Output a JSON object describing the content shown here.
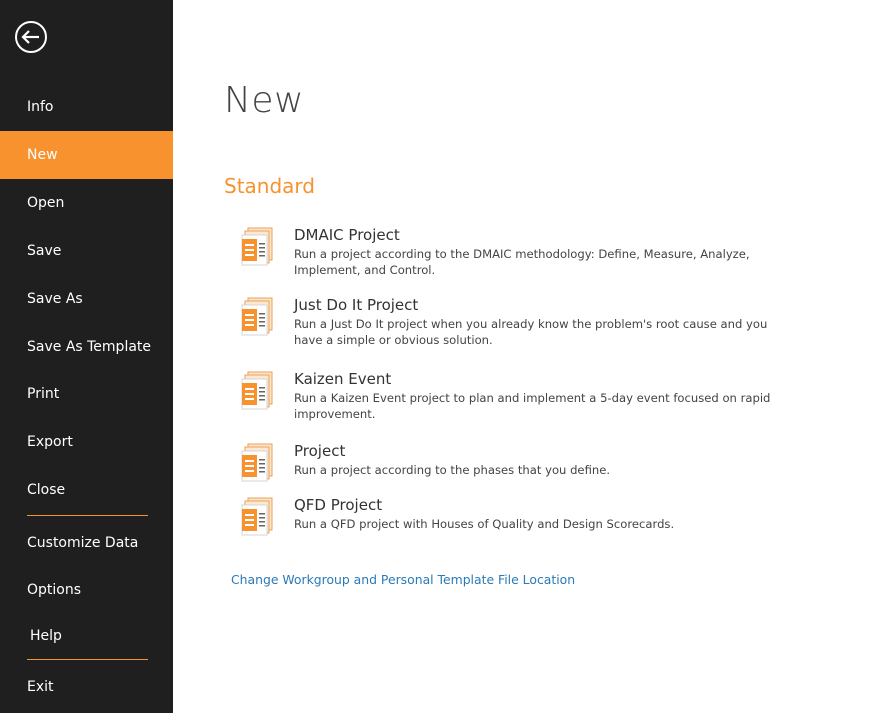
{
  "sidebar": {
    "items": [
      {
        "label": "Info"
      },
      {
        "label": "New"
      },
      {
        "label": "Open"
      },
      {
        "label": "Save"
      },
      {
        "label": "Save As"
      },
      {
        "label": "Save As Template"
      },
      {
        "label": "Print"
      },
      {
        "label": "Export"
      },
      {
        "label": "Close"
      },
      {
        "label": "Customize Data"
      },
      {
        "label": "Options"
      },
      {
        "label": "Help"
      },
      {
        "label": "Exit"
      }
    ],
    "active_index": 1
  },
  "main": {
    "title": "New",
    "section": "Standard",
    "templates": [
      {
        "name": "DMAIC Project",
        "description": "Run a project according to the DMAIC methodology: Define, Measure, Analyze, Implement, and Control."
      },
      {
        "name": "Just Do It Project",
        "description": "Run a Just Do It project when you already know the problem's root cause and you have a simple or obvious solution."
      },
      {
        "name": "Kaizen Event",
        "description": "Run a Kaizen Event project to plan and implement a 5-day event focused on rapid improvement."
      },
      {
        "name": "Project",
        "description": "Run a project according to the phases that you define."
      },
      {
        "name": "QFD Project",
        "description": "Run a QFD project with Houses of Quality and Design Scorecards."
      }
    ],
    "link": "Change Workgroup and Personal Template File Location"
  },
  "colors": {
    "accent": "#f7922e",
    "sidebar_bg": "#1f1f1f",
    "link": "#2a7ab8"
  },
  "icons": {
    "back": "back-arrow-icon",
    "template": "project-template-icon"
  }
}
